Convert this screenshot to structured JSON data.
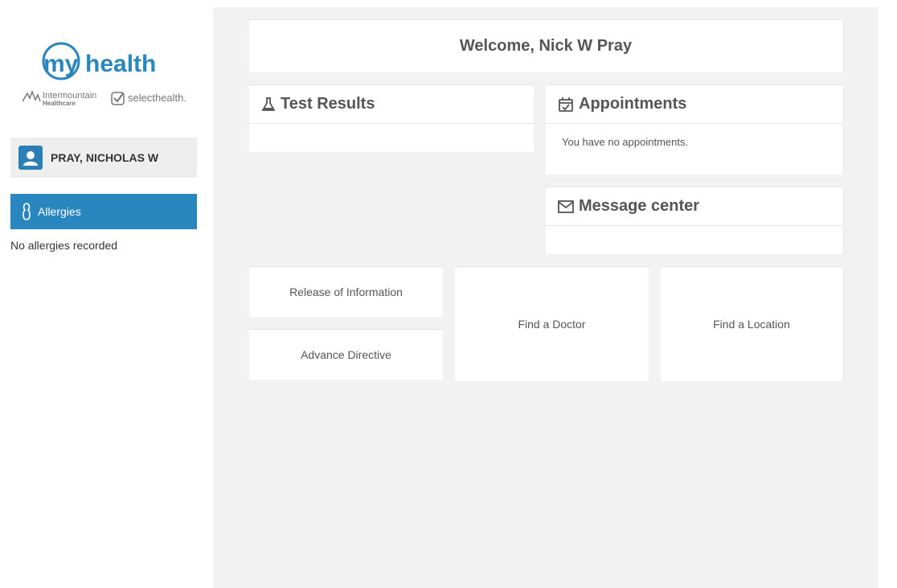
{
  "brand": {
    "logo_my": "my",
    "logo_health": "health",
    "partner1": "Intermountain",
    "partner1_sub": "Healthcare",
    "partner2": "selecthealth.",
    "color_primary": "#2a86bf"
  },
  "sidebar": {
    "patient_name": "PRAY, NICHOLAS W",
    "allergies_label": "Allergies",
    "allergies_status": "No allergies recorded"
  },
  "main": {
    "welcome": "Welcome, Nick W Pray",
    "test_results": {
      "title": "Test Results",
      "icon": "flask-icon"
    },
    "appointments": {
      "title": "Appointments",
      "icon": "calendar-check-icon",
      "body": "You have no appointments."
    },
    "messages": {
      "title": "Message center",
      "icon": "envelope-icon"
    },
    "tiles": {
      "release": "Release of Information",
      "advance": "Advance Directive",
      "doctor": "Find a Doctor",
      "location": "Find a Location"
    }
  }
}
